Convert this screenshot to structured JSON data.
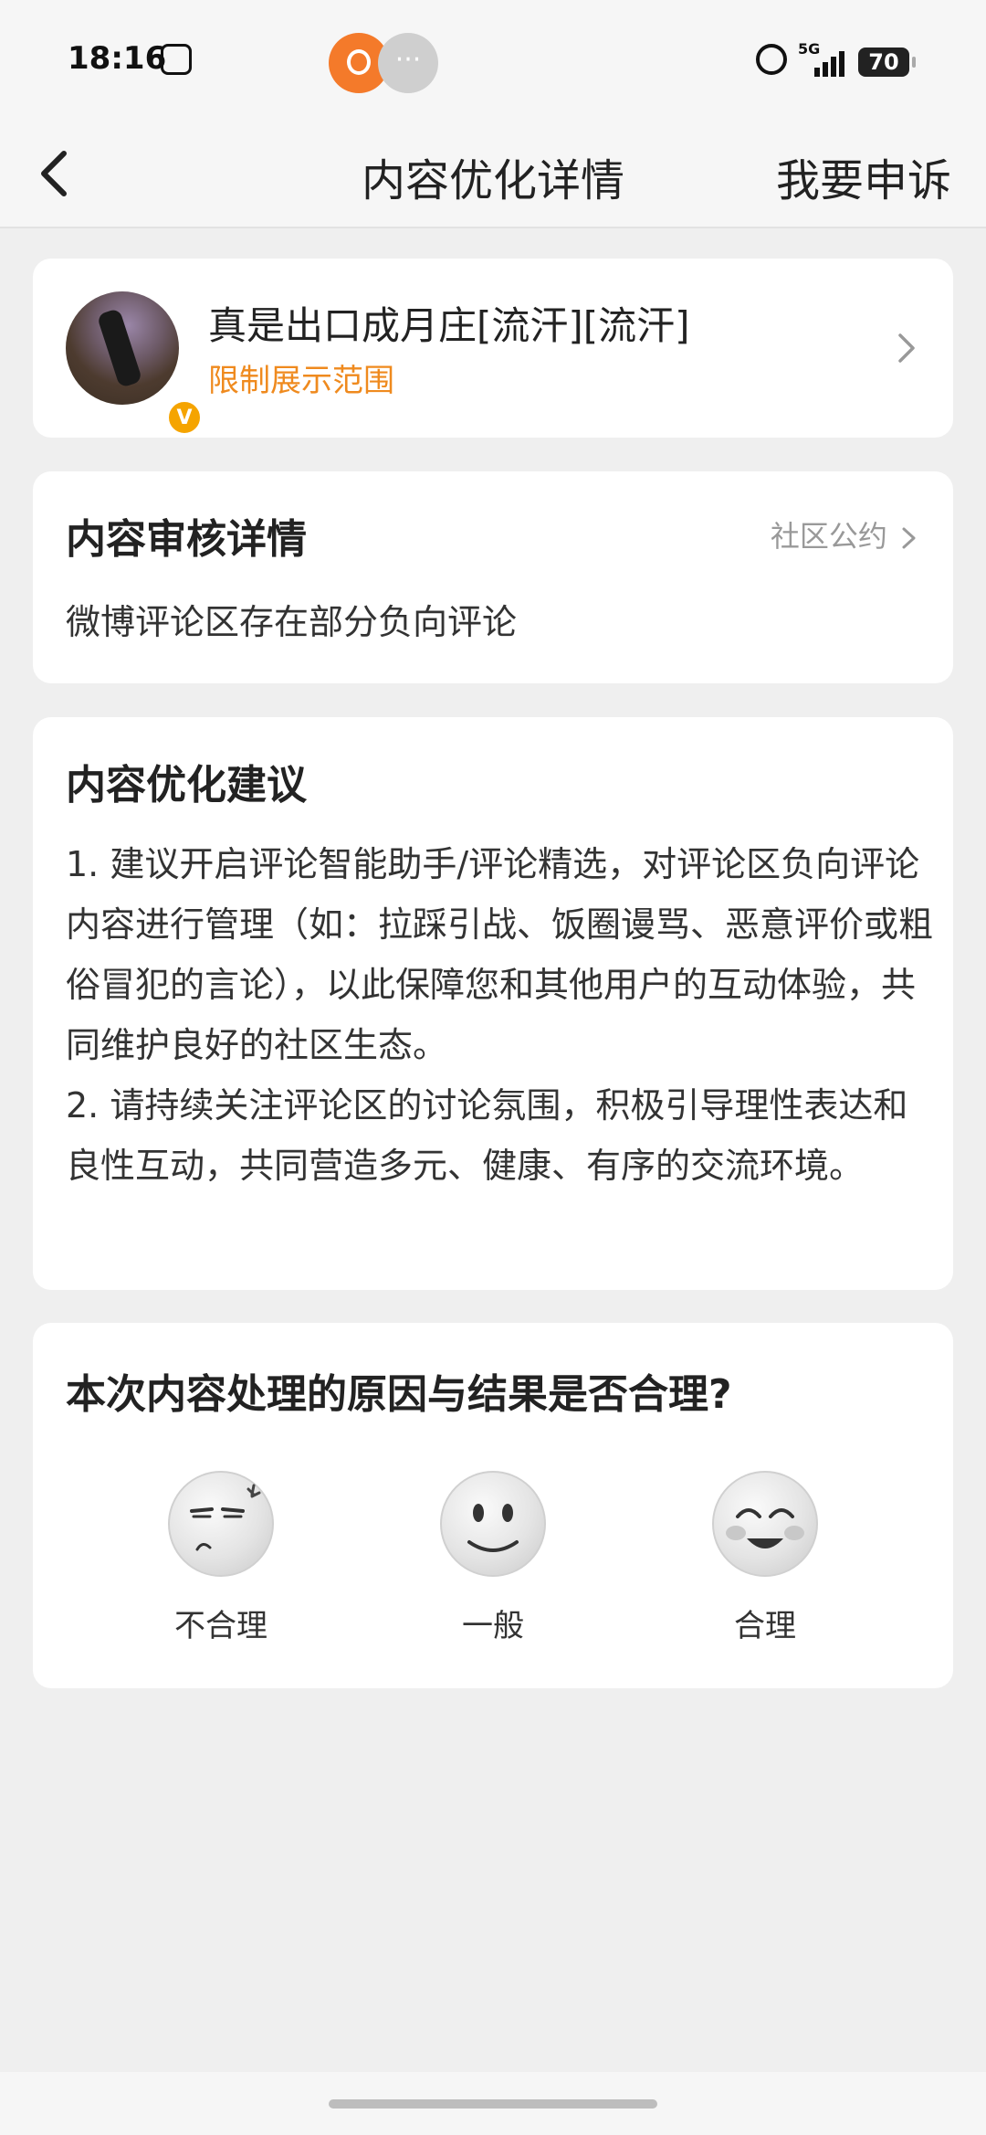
{
  "status": {
    "time": "18:16",
    "network": "5G",
    "battery": "70"
  },
  "nav": {
    "title": "内容优化详情",
    "appeal": "我要申诉"
  },
  "user": {
    "title": "真是出口成月庄[流汗][流汗]",
    "status": "限制展示范围",
    "badge": "V"
  },
  "review": {
    "title": "内容审核详情",
    "link": "社区公约",
    "text": "微博评论区存在部分负向评论"
  },
  "suggest": {
    "title": "内容优化建议",
    "items": [
      "1. 建议开启评论智能助手/评论精选，对评论区负向评论内容进行管理（如：拉踩引战、饭圈谩骂、恶意评价或粗俗冒犯的言论），以此保障您和其他用户的互动体验，共同维护良好的社区生态。",
      "2. 请持续关注评论区的讨论氛围，积极引导理性表达和良性互动，共同营造多元、健康、有序的交流环境。"
    ]
  },
  "feedback": {
    "title": "本次内容处理的原因与结果是否合理?",
    "options": [
      {
        "label": "不合理",
        "icon": "annoyed-face-icon"
      },
      {
        "label": "一般",
        "icon": "neutral-face-icon"
      },
      {
        "label": "合理",
        "icon": "smiling-face-icon"
      }
    ]
  },
  "colors": {
    "accent": "#ef8a1e",
    "background": "#efefef",
    "card": "#ffffff"
  }
}
